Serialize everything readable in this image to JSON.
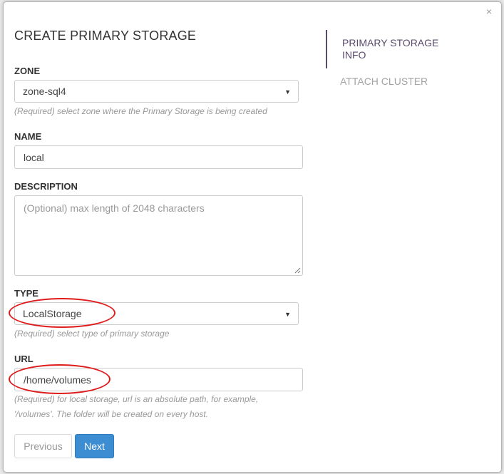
{
  "dialog": {
    "title": "CREATE PRIMARY STORAGE",
    "close_glyph": "×"
  },
  "form": {
    "zone": {
      "label": "ZONE",
      "value": "zone-sql4",
      "help": "(Required) select zone where the Primary Storage is being created"
    },
    "name": {
      "label": "NAME",
      "value": "local"
    },
    "description": {
      "label": "DESCRIPTION",
      "placeholder": "(Optional) max length of 2048 characters"
    },
    "type": {
      "label": "TYPE",
      "value": "LocalStorage",
      "help": "(Required) select type of primary storage"
    },
    "url": {
      "label": "URL",
      "value": "/home/volumes",
      "help_line1": "(Required) for local storage, url is an absolute path, for example,",
      "help_line2": "'/volumes'. The folder will be created on every host."
    }
  },
  "buttons": {
    "previous": "Previous",
    "next": "Next"
  },
  "steps": {
    "active": "PRIMARY STORAGE INFO",
    "next": "ATTACH CLUSTER"
  },
  "colors": {
    "accent_blue": "#3c8dd2",
    "step_active": "#5a4b6e",
    "annotation_red": "#e01b1b"
  },
  "icons": {
    "close": "close-icon",
    "select_caret": "caret-down-icon",
    "resize": "resize-grip-icon"
  }
}
